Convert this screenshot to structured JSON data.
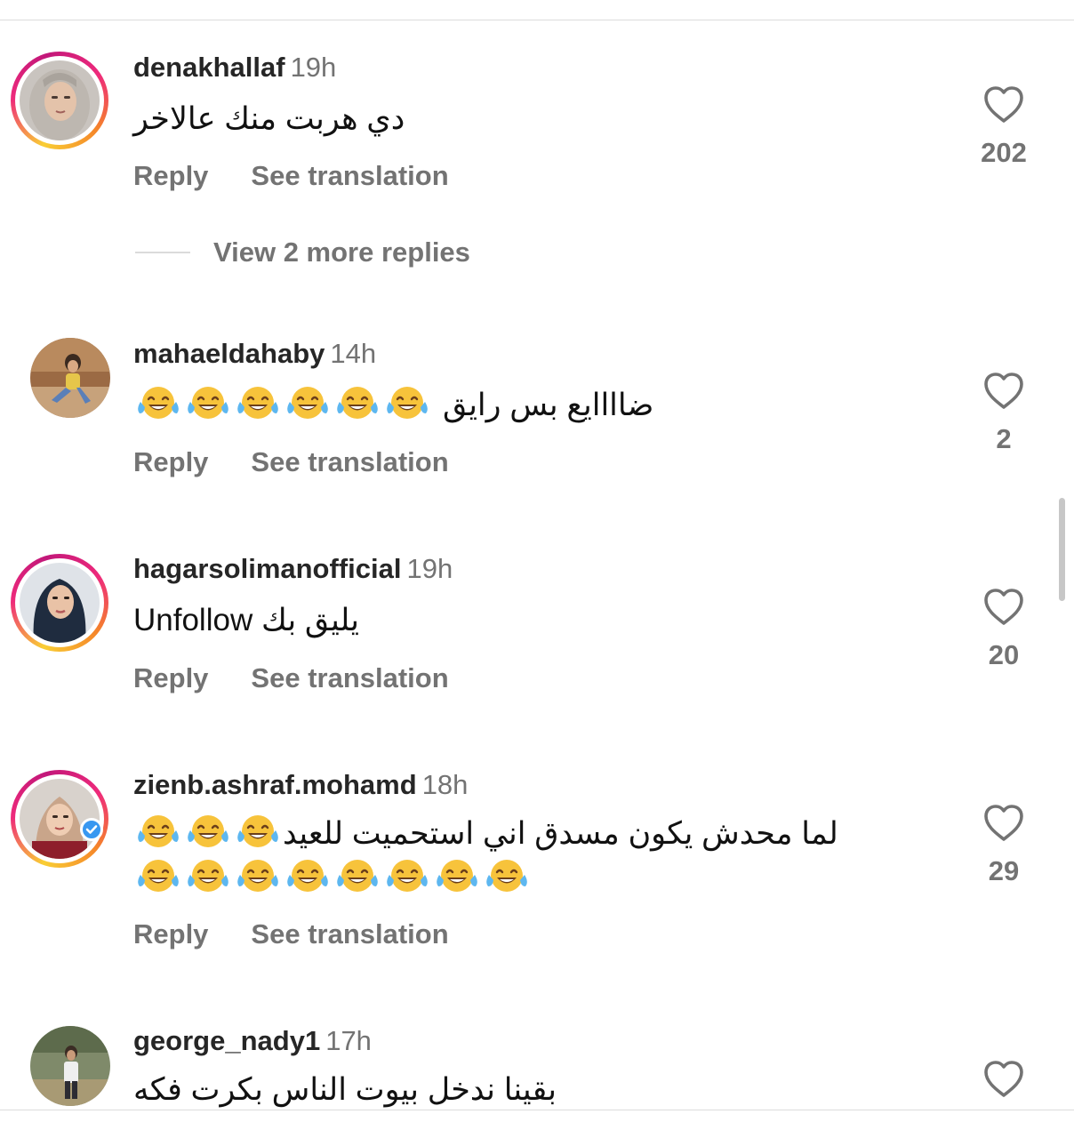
{
  "comments": [
    {
      "username": "denakhallaf",
      "time": "19h",
      "text": "دي هربت منك عالاخر",
      "reply_label": "Reply",
      "translate_label": "See translation",
      "likes": "202",
      "story_ring": true
    },
    {
      "username": "mahaeldahaby",
      "time": "14h",
      "text": "ضاااايع بس رايق",
      "emoji_count": 6,
      "reply_label": "Reply",
      "translate_label": "See translation",
      "likes": "2",
      "story_ring": false
    },
    {
      "username": "hagarsolimanofficial",
      "time": "19h",
      "text": "Unfollow يليق بك",
      "reply_label": "Reply",
      "translate_label": "See translation",
      "likes": "20",
      "story_ring": true
    },
    {
      "username": "zienb.ashraf.mohamd",
      "time": "18h",
      "text": "لما محدش يكون مسدق اني استحميت للعيد",
      "emoji_count_line1": 3,
      "emoji_count_line2": 8,
      "reply_label": "Reply",
      "translate_label": "See translation",
      "likes": "29",
      "story_ring": true,
      "verified": true
    },
    {
      "username": "george_nady1",
      "time": "17h",
      "text": "بقينا ندخل بيوت الناس بكرت فكه",
      "story_ring": false
    }
  ],
  "view_more_replies": "View 2 more replies",
  "icons": {
    "like": "heart-outline-icon",
    "emoji": "face-with-tears-of-joy"
  },
  "colors": {
    "secondary_text": "#737373",
    "story_ring_gradient": [
      "#f9ce34",
      "#ee2a7b",
      "#f58529"
    ]
  }
}
